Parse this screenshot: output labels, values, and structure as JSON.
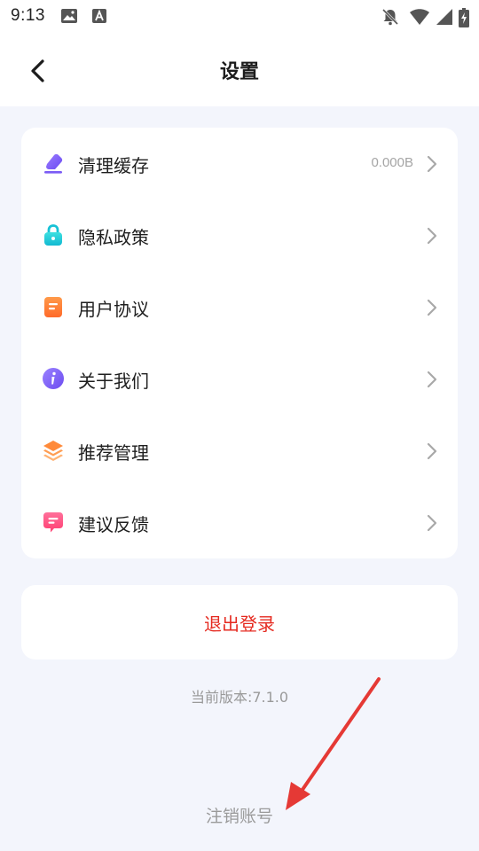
{
  "status_bar": {
    "time": "9:13"
  },
  "header": {
    "title": "设置"
  },
  "settings": {
    "items": [
      {
        "label": "清理缓存",
        "value": "0.000B",
        "icon": "eraser-icon"
      },
      {
        "label": "隐私政策",
        "icon": "lock-icon"
      },
      {
        "label": "用户协议",
        "icon": "document-icon"
      },
      {
        "label": "关于我们",
        "icon": "info-icon"
      },
      {
        "label": "推荐管理",
        "icon": "layers-icon"
      },
      {
        "label": "建议反馈",
        "icon": "feedback-icon"
      }
    ]
  },
  "logout": {
    "label": "退出登录"
  },
  "version": {
    "text": "当前版本:7.1.0"
  },
  "delete_account": {
    "label": "注销账号"
  },
  "colors": {
    "background": "#f3f5fc",
    "danger": "#e52a20",
    "muted": "#9a9a9a",
    "annotation": "#e53935"
  }
}
